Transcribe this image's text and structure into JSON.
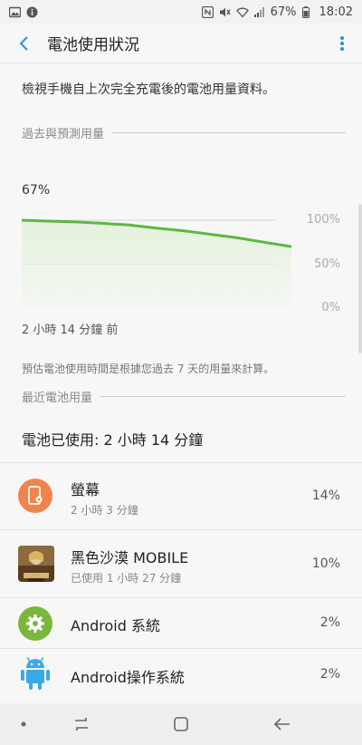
{
  "status_bar": {
    "battery_percent": "67%",
    "time": "18:02"
  },
  "app_bar": {
    "title": "電池使用狀況"
  },
  "description": "檢視手機自上次完全充電後的電池用量資料。",
  "section_past": {
    "title": "過去與預測用量"
  },
  "chart_data": {
    "type": "area",
    "current_label": "67%",
    "x_label": "2 小時 14 分鐘 前",
    "y_ticks": [
      "100%",
      "50%",
      "0%"
    ],
    "ylim": [
      0,
      100
    ],
    "x": [
      0,
      0.1,
      0.2,
      0.3,
      0.4,
      0.5,
      0.6,
      0.7,
      0.8,
      0.9,
      1.0
    ],
    "values": [
      100,
      99,
      98,
      96.5,
      94.5,
      91,
      88,
      84,
      80,
      75,
      70
    ],
    "color": "#5cb840",
    "fill": "#e4f2dd"
  },
  "note": "預估電池使用時間是根據您過去 7 天的用量來計算。",
  "section_recent": {
    "title": "最近電池用量"
  },
  "usage_summary": "電池已使用: 2 小時 14 分鐘",
  "items": [
    {
      "name": "螢幕",
      "sub": "2 小時 3 分鐘",
      "pct": "14%",
      "icon": "screen-icon",
      "color": "#f0844a"
    },
    {
      "name": "黑色沙漠 MOBILE",
      "sub": "已使用 1 小時 27 分鐘",
      "pct": "10%",
      "icon": "game-icon",
      "color": "#6a4a2a"
    },
    {
      "name": "Android 系統",
      "sub": "",
      "pct": "2%",
      "icon": "gear-icon",
      "color": "#79b83c"
    },
    {
      "name": "Android操作系統",
      "sub": "",
      "pct": "2%",
      "icon": "android-icon",
      "color": "#3aa9e8"
    }
  ]
}
